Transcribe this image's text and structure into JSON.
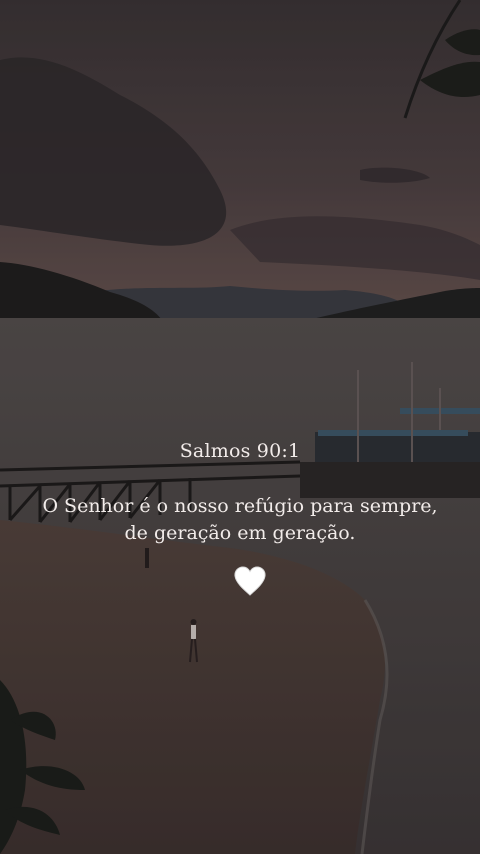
{
  "verse": {
    "reference": "Salmos 90:1",
    "text": "O Senhor é o nosso refúgio para sempre, de geração em geração."
  },
  "heart_icon": "white-heart-icon",
  "colors": {
    "sky_top": "#3c3638",
    "sky_mid": "#5a4c4c",
    "water": "#4a4446",
    "sand": "#4d3f3a",
    "text": "#f2ecea"
  }
}
